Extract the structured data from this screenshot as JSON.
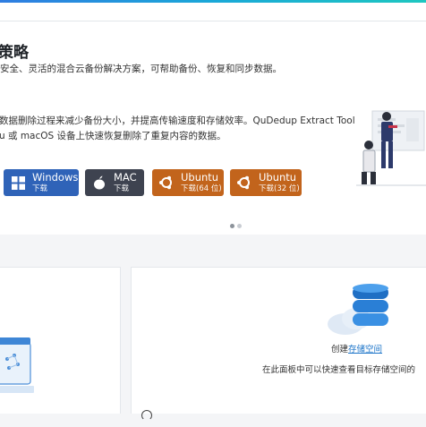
{
  "hero": {
    "title": "策略",
    "subtitle": "安全、灵活的混合云备份解决方案，可帮助备份、恢复和同步数据。",
    "desc_line1": "数据删除过程来减少备份大小，并提高传输速度和存储效率。QuDedup Extract Tool",
    "desc_line2": "u 或 macOS 设备上快速恢复删除了重复内容的数据。"
  },
  "downloads": {
    "windows": {
      "label": "Windows",
      "sub": "下载"
    },
    "mac": {
      "label": "MAC",
      "sub": "下载"
    },
    "ubuntu64": {
      "label": "Ubuntu",
      "sub": "下载(64 位)"
    },
    "ubuntu32": {
      "label": "Ubuntu",
      "sub": "下载(32 位)"
    }
  },
  "storage_panel": {
    "create_prefix": "创建",
    "create_link": "存储空间",
    "description": "在此面板中可以快速查看目标存储空间的"
  },
  "colors": {
    "windows_btn": "#2f63b8",
    "mac_btn": "#3e4350",
    "ubuntu_btn": "#c2641c",
    "link": "#1a73c8",
    "accent_gradient_start": "#2f7de1",
    "accent_gradient_end": "#1ec7c0"
  },
  "icons": [
    "windows-icon",
    "apple-icon",
    "ubuntu-icon",
    "storage-cloud-icon",
    "people-illustration"
  ]
}
